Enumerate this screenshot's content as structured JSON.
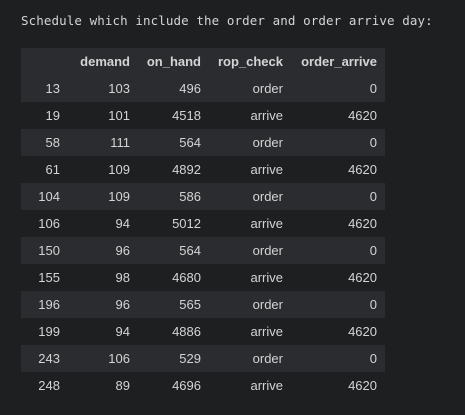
{
  "caption": "Schedule which include the order and order arrive day:",
  "table": {
    "index_header": "",
    "columns": [
      "demand",
      "on_hand",
      "rop_check",
      "order_arrive"
    ],
    "rows": [
      {
        "index": "13",
        "cells": [
          "103",
          "496",
          "order",
          "0"
        ]
      },
      {
        "index": "19",
        "cells": [
          "101",
          "4518",
          "arrive",
          "4620"
        ]
      },
      {
        "index": "58",
        "cells": [
          "111",
          "564",
          "order",
          "0"
        ]
      },
      {
        "index": "61",
        "cells": [
          "109",
          "4892",
          "arrive",
          "4620"
        ]
      },
      {
        "index": "104",
        "cells": [
          "109",
          "586",
          "order",
          "0"
        ]
      },
      {
        "index": "106",
        "cells": [
          "94",
          "5012",
          "arrive",
          "4620"
        ]
      },
      {
        "index": "150",
        "cells": [
          "96",
          "564",
          "order",
          "0"
        ]
      },
      {
        "index": "155",
        "cells": [
          "98",
          "4680",
          "arrive",
          "4620"
        ]
      },
      {
        "index": "196",
        "cells": [
          "96",
          "565",
          "order",
          "0"
        ]
      },
      {
        "index": "199",
        "cells": [
          "94",
          "4886",
          "arrive",
          "4620"
        ]
      },
      {
        "index": "243",
        "cells": [
          "106",
          "529",
          "order",
          "0"
        ]
      },
      {
        "index": "248",
        "cells": [
          "89",
          "4696",
          "arrive",
          "4620"
        ]
      }
    ]
  }
}
